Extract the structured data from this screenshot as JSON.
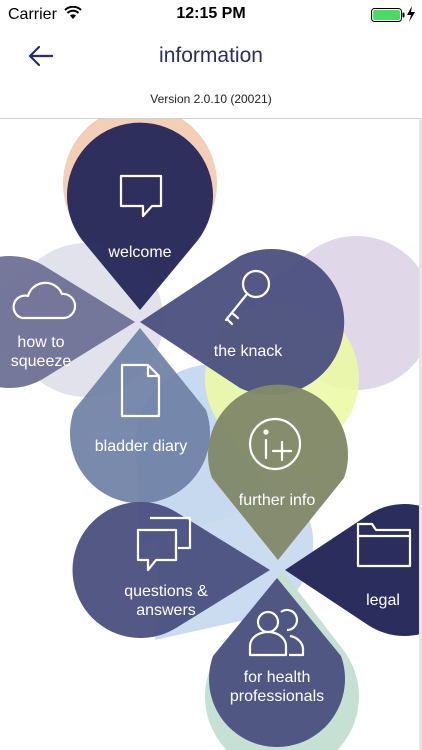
{
  "status_bar": {
    "carrier": "Carrier",
    "time": "12:15 PM"
  },
  "header": {
    "title": "information"
  },
  "version_text": "Version 2.0.10 (20021)",
  "menu": {
    "welcome": "welcome",
    "the_knack": "the knack",
    "how_to_squeeze": [
      "how to",
      "squeeze"
    ],
    "bladder_diary": "bladder diary",
    "further_info": "further info",
    "questions_answers": [
      "questions &",
      "answers"
    ],
    "legal": "legal",
    "health_professionals": [
      "for health",
      "professionals"
    ]
  },
  "icons": [
    "back-arrow-icon",
    "speech-bubble-icon",
    "key-icon",
    "cloud-icon",
    "document-icon",
    "info-plus-icon",
    "chat-bubbles-icon",
    "folder-icon",
    "people-icon",
    "wifi-icon",
    "battery-icon",
    "charging-bolt-icon"
  ],
  "colors": {
    "navy": "#27295a",
    "slate": "#4a4f7e",
    "grey_blue": "#6e7096",
    "blue_grey": "#6f81a6",
    "olive": "#82896a",
    "peach": "#f4cfb8",
    "lilac": "#ddd3e7",
    "light_blue": "#bcd4ee",
    "lime": "#ecf9a6",
    "mint": "#c6e0d4",
    "battery": "#4cd964"
  }
}
